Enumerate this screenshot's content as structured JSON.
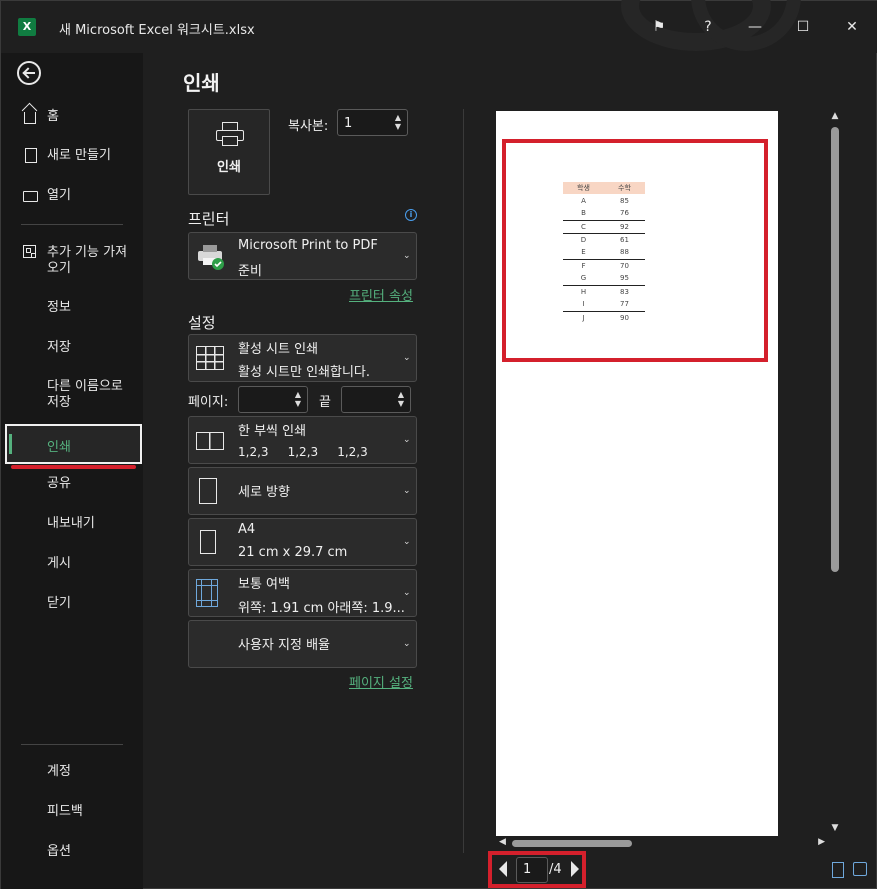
{
  "window": {
    "title": "새 Microsoft Excel 워크시트.xlsx",
    "app_icon_letter": "X",
    "buttons": {
      "feedback": "⚑",
      "help": "?",
      "minimize": "—",
      "maximize": "☐",
      "close": "✕"
    }
  },
  "sidebar": {
    "items": [
      {
        "label": "홈",
        "icon": "home-icon"
      },
      {
        "label": "새로 만들기",
        "icon": "new-document-icon"
      },
      {
        "label": "열기",
        "icon": "open-folder-icon"
      },
      {
        "label": "추가 기능 가져오기",
        "line1": "추가 기능 가져",
        "line2": "오기",
        "icon": "addins-icon"
      },
      {
        "label": "정보"
      },
      {
        "label": "저장"
      },
      {
        "label": "다른 이름으로 저장",
        "line1": "다른 이름으로",
        "line2": "저장"
      },
      {
        "label": "인쇄",
        "active": true
      },
      {
        "label": "공유"
      },
      {
        "label": "내보내기"
      },
      {
        "label": "게시"
      },
      {
        "label": "닫기"
      }
    ],
    "bottom": [
      {
        "label": "계정"
      },
      {
        "label": "피드백"
      },
      {
        "label": "옵션"
      }
    ]
  },
  "print_panel": {
    "title": "인쇄",
    "print_button": "인쇄",
    "copies_label": "복사본:",
    "copies_value": "1",
    "printer_section": "프린터",
    "printer_name": "Microsoft Print to PDF",
    "printer_status": "준비",
    "printer_properties_link": "프린터 속성",
    "settings_section": "설정",
    "scope": {
      "title": "활성 시트 인쇄",
      "subtitle": "활성 시트만 인쇄합니다."
    },
    "pages_label": "페이지:",
    "to_label": "끝",
    "pages_from": "",
    "pages_to": "",
    "collate": {
      "title": "한 부씩 인쇄",
      "subtitle": "1,2,3     1,2,3     1,2,3"
    },
    "orientation": {
      "title": "세로 방향"
    },
    "paper": {
      "title": "A4",
      "subtitle": "21 cm x 29.7 cm"
    },
    "margins": {
      "title": "보통 여백",
      "subtitle": "위쪽: 1.91 cm 아래쪽: 1.9..."
    },
    "scaling": {
      "title": "사용자 지정 배율"
    },
    "page_setup_link": "페이지 설정"
  },
  "preview": {
    "table": {
      "headers": [
        "학생",
        "수학"
      ],
      "rows": [
        [
          "A",
          "85"
        ],
        [
          "B",
          "76"
        ],
        [
          "C",
          "92"
        ],
        [
          "D",
          "61"
        ],
        [
          "E",
          "88"
        ],
        [
          "F",
          "70"
        ],
        [
          "G",
          "95"
        ],
        [
          "H",
          "83"
        ],
        [
          "I",
          "77"
        ],
        [
          "J",
          "90"
        ]
      ]
    },
    "current_page": "1",
    "total_pages": "/4"
  },
  "colors": {
    "accent_green": "#55b17e",
    "highlight_red": "#d4202c",
    "background": "#1f1f1f",
    "sidebar": "#171717"
  }
}
